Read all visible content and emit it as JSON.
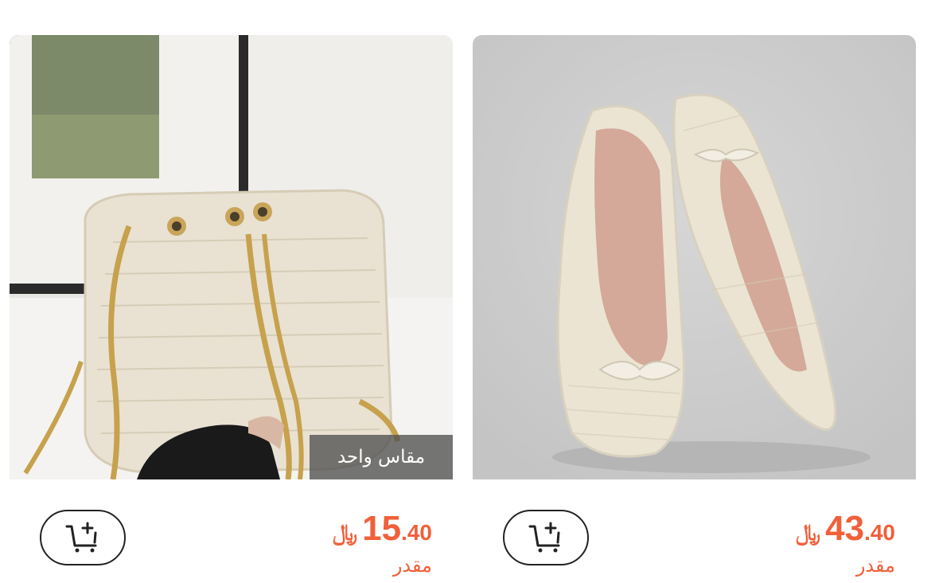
{
  "products": [
    {
      "position": "left",
      "name": "straw-bucket-bag",
      "size_badge": "مقاس واحد",
      "currency": "﷼",
      "price_int": "15",
      "price_dec": ".40",
      "price_label": "مقدر",
      "cart_icon": "add-to-cart-icon"
    },
    {
      "position": "right",
      "name": "crochet-ballet-flats",
      "currency": "﷼",
      "price_int": "43",
      "price_dec": ".40",
      "price_label": "مقدر",
      "cart_icon": "add-to-cart-icon"
    }
  ],
  "colors": {
    "accent": "#f0603a",
    "badge_bg": "#505050"
  }
}
